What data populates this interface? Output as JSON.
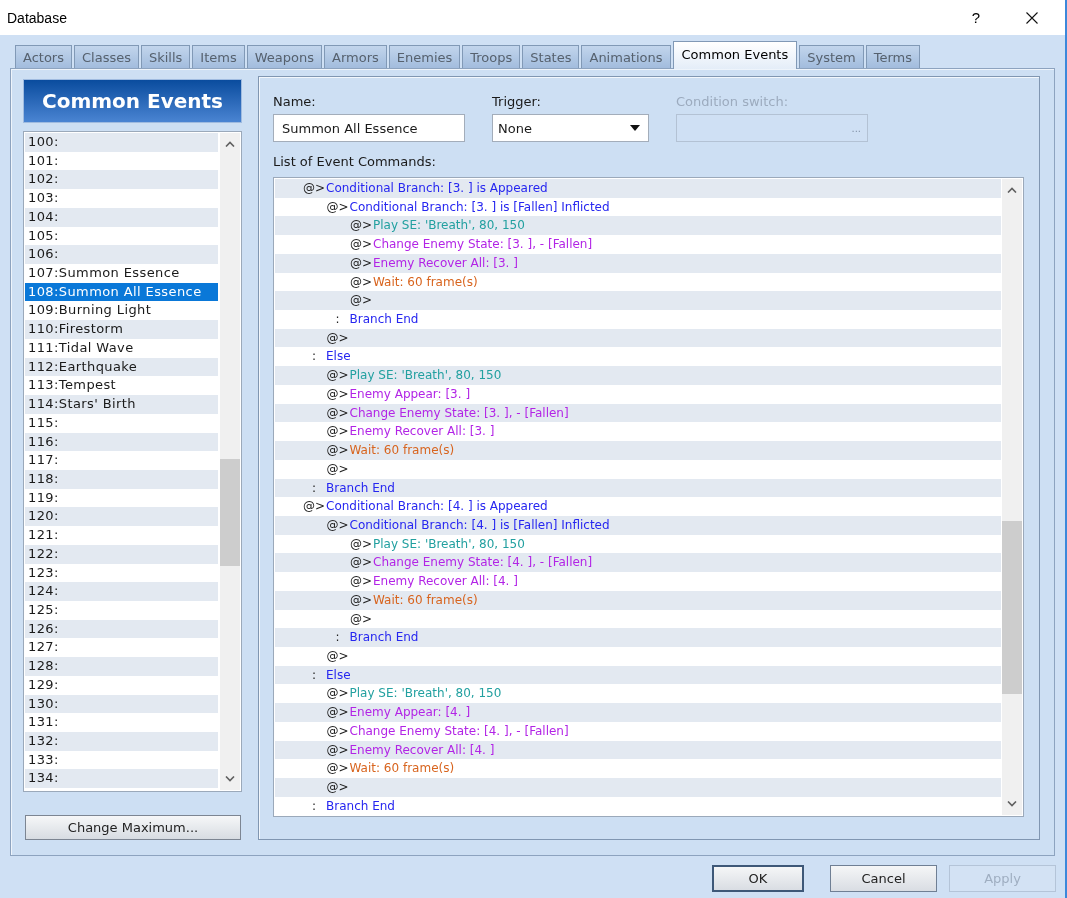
{
  "window": {
    "title": "Database",
    "help_button": "?"
  },
  "tabs": [
    {
      "label": "Actors",
      "selected": false
    },
    {
      "label": "Classes",
      "selected": false
    },
    {
      "label": "Skills",
      "selected": false
    },
    {
      "label": "Items",
      "selected": false
    },
    {
      "label": "Weapons",
      "selected": false
    },
    {
      "label": "Armors",
      "selected": false
    },
    {
      "label": "Enemies",
      "selected": false
    },
    {
      "label": "Troops",
      "selected": false
    },
    {
      "label": "States",
      "selected": false
    },
    {
      "label": "Animations",
      "selected": false
    },
    {
      "label": "Common Events",
      "selected": true
    },
    {
      "label": "System",
      "selected": false
    },
    {
      "label": "Terms",
      "selected": false
    }
  ],
  "sidebar": {
    "title": "Common Events",
    "events": [
      {
        "label": "100:",
        "selected": false
      },
      {
        "label": "101:",
        "selected": false
      },
      {
        "label": "102:",
        "selected": false
      },
      {
        "label": "103:",
        "selected": false
      },
      {
        "label": "104:",
        "selected": false
      },
      {
        "label": "105:",
        "selected": false
      },
      {
        "label": "106:",
        "selected": false
      },
      {
        "label": "107:Summon Essence",
        "selected": false
      },
      {
        "label": "108:Summon All Essence",
        "selected": true
      },
      {
        "label": "109:Burning Light",
        "selected": false
      },
      {
        "label": "110:Firestorm",
        "selected": false
      },
      {
        "label": "111:Tidal Wave",
        "selected": false
      },
      {
        "label": "112:Earthquake",
        "selected": false
      },
      {
        "label": "113:Tempest",
        "selected": false
      },
      {
        "label": "114:Stars' Birth",
        "selected": false
      },
      {
        "label": "115:",
        "selected": false
      },
      {
        "label": "116:",
        "selected": false
      },
      {
        "label": "117:",
        "selected": false
      },
      {
        "label": "118:",
        "selected": false
      },
      {
        "label": "119:",
        "selected": false
      },
      {
        "label": "120:",
        "selected": false
      },
      {
        "label": "121:",
        "selected": false
      },
      {
        "label": "122:",
        "selected": false
      },
      {
        "label": "123:",
        "selected": false
      },
      {
        "label": "124:",
        "selected": false
      },
      {
        "label": "125:",
        "selected": false
      },
      {
        "label": "126:",
        "selected": false
      },
      {
        "label": "127:",
        "selected": false
      },
      {
        "label": "128:",
        "selected": false
      },
      {
        "label": "129:",
        "selected": false
      },
      {
        "label": "130:",
        "selected": false
      },
      {
        "label": "131:",
        "selected": false
      },
      {
        "label": "132:",
        "selected": false
      },
      {
        "label": "133:",
        "selected": false
      },
      {
        "label": "134:",
        "selected": false
      }
    ],
    "change_maximum_button": "Change Maximum..."
  },
  "editor": {
    "name": {
      "label": "Name:",
      "value": "Summon All Essence"
    },
    "trigger": {
      "label": "Trigger:",
      "value": "None"
    },
    "condition_switch": {
      "label": "Condition switch:",
      "disabled": true,
      "browse_button": "..."
    },
    "commands_label": "List of Event Commands:",
    "commands": [
      {
        "prefix": "@>",
        "text": "Conditional Branch: [3. ] is Appeared",
        "kind": "flow",
        "children": [
          {
            "prefix": "@>",
            "text": "Conditional Branch: [3. ] is [Fallen] Inflicted",
            "kind": "flow",
            "children": [
              {
                "prefix": "@>",
                "text": "Play SE: 'Breath', 80, 150",
                "kind": "audio"
              },
              {
                "prefix": "@>",
                "text": "Change Enemy State: [3. ], - [Fallen]",
                "kind": "battle"
              },
              {
                "prefix": "@>",
                "text": "Enemy Recover All: [3. ]",
                "kind": "battle"
              },
              {
                "prefix": "@>",
                "text": "Wait: 60 frame(s)",
                "kind": "wait"
              },
              {
                "prefix": "@>"
              }
            ]
          },
          {
            "prefix": ":",
            "text": "Branch End",
            "kind": "flow"
          },
          {
            "prefix": "@>"
          }
        ]
      },
      {
        "prefix": ":",
        "text": "Else",
        "kind": "flow",
        "children": [
          {
            "prefix": "@>",
            "text": "Play SE: 'Breath', 80, 150",
            "kind": "audio"
          },
          {
            "prefix": "@>",
            "text": "Enemy Appear: [3. ]",
            "kind": "battle"
          },
          {
            "prefix": "@>",
            "text": "Change Enemy State: [3. ], - [Fallen]",
            "kind": "battle"
          },
          {
            "prefix": "@>",
            "text": "Enemy Recover All: [3. ]",
            "kind": "battle"
          },
          {
            "prefix": "@>",
            "text": "Wait: 60 frame(s)",
            "kind": "wait"
          },
          {
            "prefix": "@>"
          }
        ]
      },
      {
        "prefix": ":",
        "text": "Branch End",
        "kind": "flow"
      },
      {
        "prefix": "@>",
        "text": "Conditional Branch: [4. ] is Appeared",
        "kind": "flow",
        "children": [
          {
            "prefix": "@>",
            "text": "Conditional Branch: [4. ] is [Fallen] Inflicted",
            "kind": "flow",
            "children": [
              {
                "prefix": "@>",
                "text": "Play SE: 'Breath', 80, 150",
                "kind": "audio"
              },
              {
                "prefix": "@>",
                "text": "Change Enemy State: [4. ], - [Fallen]",
                "kind": "battle"
              },
              {
                "prefix": "@>",
                "text": "Enemy Recover All: [4. ]",
                "kind": "battle"
              },
              {
                "prefix": "@>",
                "text": "Wait: 60 frame(s)",
                "kind": "wait"
              },
              {
                "prefix": "@>"
              }
            ]
          },
          {
            "prefix": ":",
            "text": "Branch End",
            "kind": "flow"
          },
          {
            "prefix": "@>"
          }
        ]
      },
      {
        "prefix": ":",
        "text": "Else",
        "kind": "flow",
        "children": [
          {
            "prefix": "@>",
            "text": "Play SE: 'Breath', 80, 150",
            "kind": "audio"
          },
          {
            "prefix": "@>",
            "text": "Enemy Appear: [4. ]",
            "kind": "battle"
          },
          {
            "prefix": "@>",
            "text": "Change Enemy State: [4. ], - [Fallen]",
            "kind": "battle"
          },
          {
            "prefix": "@>",
            "text": "Enemy Recover All: [4. ]",
            "kind": "battle"
          },
          {
            "prefix": "@>",
            "text": "Wait: 60 frame(s)",
            "kind": "wait"
          },
          {
            "prefix": "@>"
          }
        ]
      },
      {
        "prefix": ":",
        "text": "Branch End",
        "kind": "flow"
      }
    ]
  },
  "buttons": [
    {
      "label": "OK",
      "default": true,
      "disabled": false
    },
    {
      "label": "Cancel",
      "default": false,
      "disabled": false
    },
    {
      "label": "Apply",
      "default": false,
      "disabled": true
    }
  ]
}
